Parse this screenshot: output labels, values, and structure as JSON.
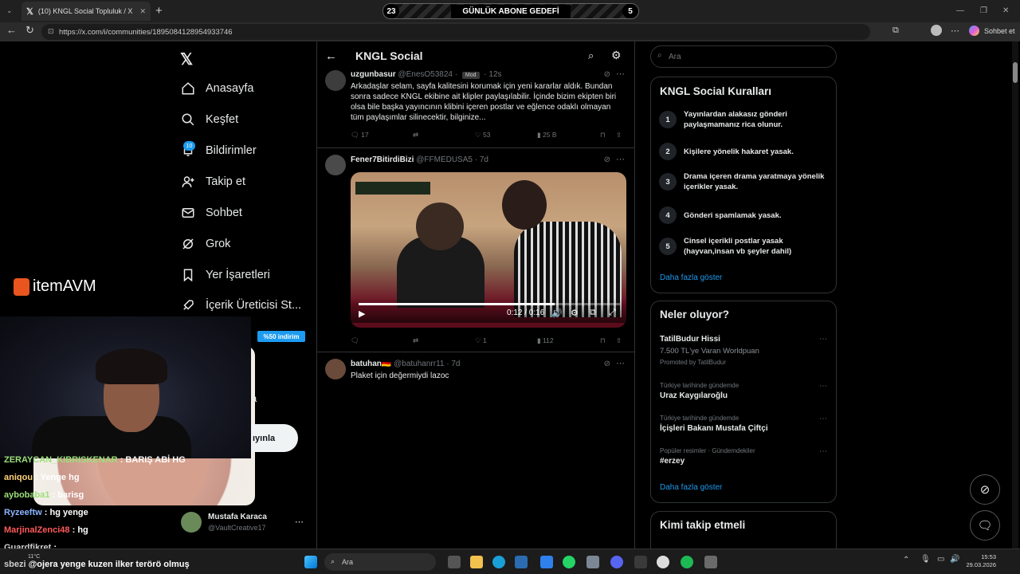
{
  "browser": {
    "tab_title": "(10) KNGL Social Topluluk / X",
    "url": "https://x.com/i/communities/1895084128954933746",
    "profile_label": "Sohbet et"
  },
  "banner": {
    "left": "23",
    "title": "GÜNLÜK ABONE GEDEFİ",
    "right": "5"
  },
  "sidebar": {
    "items": [
      {
        "label": "Anasayfa",
        "icon": "home-icon"
      },
      {
        "label": "Keşfet",
        "icon": "search-icon"
      },
      {
        "label": "Bildirimler",
        "icon": "bell-icon",
        "badge": "10"
      },
      {
        "label": "Takip et",
        "icon": "follow-icon"
      },
      {
        "label": "Sohbet",
        "icon": "mail-icon"
      },
      {
        "label": "Grok",
        "icon": "grok-icon"
      },
      {
        "label": "Yer İşaretleri",
        "icon": "bookmark-icon"
      },
      {
        "label": "İçerik Üreticisi St...",
        "icon": "rocket-icon"
      }
    ],
    "partial_label": "a",
    "post_button_partial": "ıyınla",
    "profile": {
      "name": "Mustafa Karaca",
      "handle": "@VaultCreative17"
    }
  },
  "community": {
    "title": "KNGL Social"
  },
  "tweets": [
    {
      "name": "uzgunbasur",
      "handle": "@EnesO53824",
      "badge": "Mod",
      "time": "12s",
      "text": "Arkadaşlar selam, sayfa kalitesini korumak için yeni kararlar aldık. Bundan sonra sadece KNGL ekibine ait klipler paylaşılabilir. İçinde bizim ekipten biri olsa bile başka yayıncının klibini içeren postlar ve eğlence odaklı olmayan tüm paylaşımlar silinecektir, bilginize...",
      "replies": "17",
      "likes": "53",
      "views": "25 B"
    },
    {
      "name": "Fener7BitirdiBizi",
      "handle": "@FFMEDUSA5",
      "time": "7d",
      "video_time": "0:12 / 0:16",
      "video_progress": 0.75,
      "replies": "",
      "likes": "1",
      "views": "112"
    },
    {
      "name": "batuhan🇩🇪",
      "handle": "@batuhanrr11",
      "time": "7d",
      "text": "Plaket için değermiydi lazoc"
    }
  ],
  "right": {
    "search_placeholder": "Ara",
    "rules_title": "KNGL Social Kuralları",
    "rules": [
      {
        "n": "1",
        "text": "Yayınlardan alakasız gönderi paylaşmamanız rica olunur."
      },
      {
        "n": "2",
        "text": "Kişilere yönelik hakaret yasak."
      },
      {
        "n": "3",
        "text": "Drama içeren drama yaratmaya yönelik içerikler yasak."
      },
      {
        "n": "4",
        "text": "Gönderi spamlamak yasak."
      },
      {
        "n": "5",
        "text": "Cinsel içerikli postlar yasak (hayvan,insan vb şeyler dahil)"
      }
    ],
    "rules_more": "Daha fazla göster",
    "trends_title": "Neler oluyor?",
    "trends": [
      {
        "meta": "",
        "title": "TatilBudur Hissi",
        "sub": "7.500 TL'ye Varan Worldpuan",
        "promo": "Promoted by TatilBudur"
      },
      {
        "meta": "Türkiye tarihinde gündemde",
        "title": "Uraz Kaygılaroğlu"
      },
      {
        "meta": "Türkiye tarihinde gündemde",
        "title": "İçişleri Bakanı Mustafa Çiftçi"
      },
      {
        "meta": "Popüler resimler · Gündemdekiler",
        "title": "#erzey"
      }
    ],
    "trends_more": "Daha fazla göster",
    "follow_title": "Kimi takip etmeli"
  },
  "overlay": {
    "logo": "itemAVM",
    "promo": "%50 indirim",
    "chat": [
      {
        "user": "ZERAYCAN_KIBRISKENAR",
        "msg": ": BARIŞ ABİ HG",
        "color": "#9be07a"
      },
      {
        "user": "aniqou",
        "msg": ": Yenge hg",
        "color": "#ffd27a"
      },
      {
        "user": "aybobaba1",
        "msg": ": barisg",
        "color": "#9be07a"
      },
      {
        "user": "Ryzeeftw",
        "msg": ": hg yenge",
        "color": "#8ab4ff"
      },
      {
        "user": "MarjinalZenci48",
        "msg": ": hg",
        "color": "#ff5a5a"
      },
      {
        "user": "Guardfikret",
        "msg": ":",
        "color": "#cfcfcf"
      },
      {
        "user": "sbezi",
        "msg": "@ojera yenge kuzen ilker terörö olmuş",
        "color": "#cfcfcf"
      }
    ]
  },
  "taskbar": {
    "search": "Ara",
    "time": "15:53",
    "date": "29.03.2026",
    "weather": "11°C"
  }
}
